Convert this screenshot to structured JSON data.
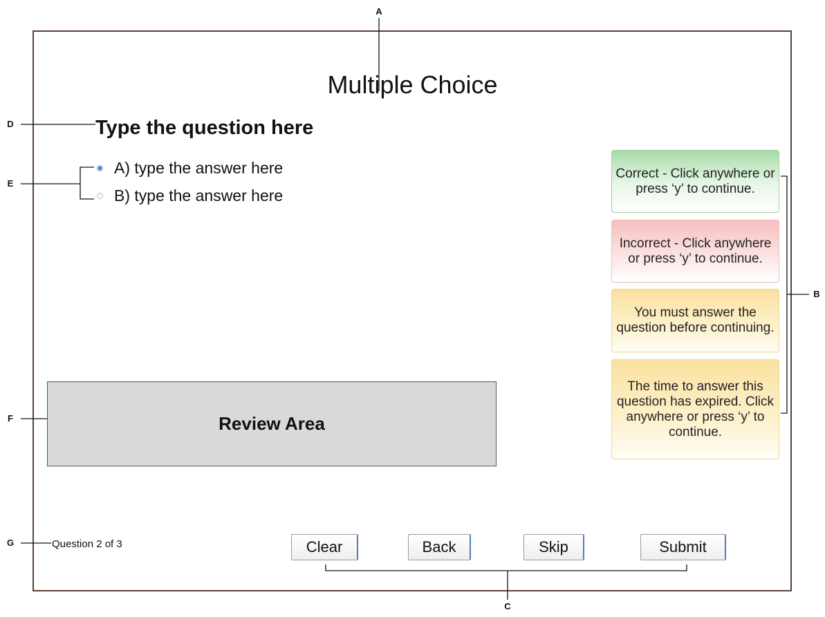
{
  "callouts": {
    "a": "A",
    "b": "B",
    "c": "C",
    "d": "D",
    "e": "E",
    "f": "F",
    "g": "G"
  },
  "slide": {
    "title": "Multiple Choice",
    "question": "Type the question here",
    "answers": [
      {
        "label": "A) type the answer here",
        "selected": true
      },
      {
        "label": "B) type the answer here",
        "selected": false
      }
    ],
    "review_area": "Review Area",
    "feedback": {
      "correct": "Correct - Click anywhere or press ‘y’ to continue.",
      "incorrect": "Incorrect - Click anywhere or press ‘y’ to continue.",
      "incomplete": "You must answer the question before continuing.",
      "timeout": "The time to answer this question has expired. Click anywhere or press ‘y’ to continue."
    },
    "progress": "Question 2 of 3",
    "buttons": {
      "clear": "Clear",
      "back": "Back",
      "skip": "Skip",
      "submit": "Submit"
    }
  },
  "colors": {
    "frame": "#5a3e35",
    "correct": "#a8dca8",
    "incorrect": "#f6bfbf",
    "warning": "#fbe1a0",
    "review_area": "#d9d9d9",
    "button_accent": "#4d7fb8"
  }
}
